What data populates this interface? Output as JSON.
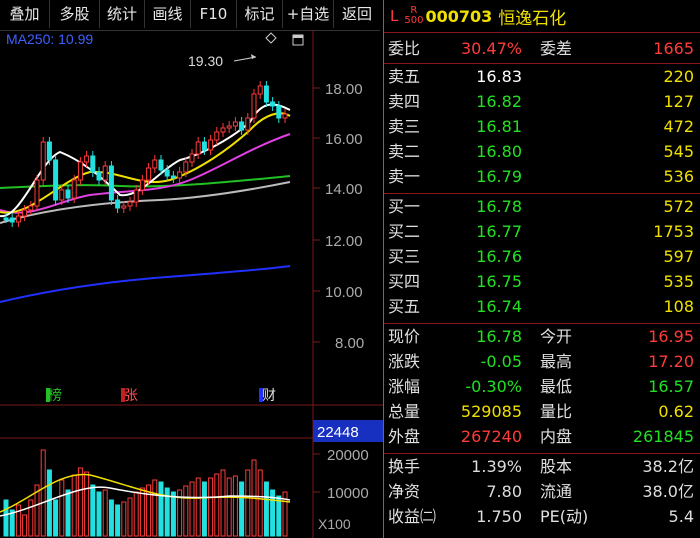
{
  "toolbar": {
    "buttons": [
      "叠加",
      "多股",
      "统计",
      "画线",
      "F10",
      "标记",
      "+自选",
      "返回"
    ]
  },
  "ma_label": "MA250: 10.99",
  "annotation_high": "19.30",
  "markers": [
    "榜",
    "张",
    "财"
  ],
  "price_axis": [
    "18.00",
    "16.00",
    "14.00",
    "12.00",
    "10.00",
    "8.00"
  ],
  "volume_axis": [
    "20000",
    "10000"
  ],
  "volume_unit": "X100",
  "volume_current": "22448",
  "colors": {
    "up": "#ff3b3b",
    "down": "#22e0e0",
    "ma5": "#ffffff",
    "ma10": "#f0e000",
    "ma20": "#e040e0",
    "ma60": "#22c022",
    "ma120": "#bbbbbb",
    "ma250": "#2030ff"
  },
  "stock": {
    "market_mark": "L",
    "rank_top": "R",
    "rank_bottom": "500",
    "code": "000703",
    "name": "恒逸石化"
  },
  "quote": {
    "ratio_label": "委比",
    "ratio": "30.47%",
    "diff_label": "委差",
    "diff": "1665",
    "asks": [
      {
        "label": "卖五",
        "price": "16.83",
        "vol": "220"
      },
      {
        "label": "卖四",
        "price": "16.82",
        "vol": "127"
      },
      {
        "label": "卖三",
        "price": "16.81",
        "vol": "472"
      },
      {
        "label": "卖二",
        "price": "16.80",
        "vol": "545"
      },
      {
        "label": "卖一",
        "price": "16.79",
        "vol": "536"
      }
    ],
    "bids": [
      {
        "label": "买一",
        "price": "16.78",
        "vol": "572"
      },
      {
        "label": "买二",
        "price": "16.77",
        "vol": "1753"
      },
      {
        "label": "买三",
        "price": "16.76",
        "vol": "597"
      },
      {
        "label": "买四",
        "price": "16.75",
        "vol": "535"
      },
      {
        "label": "买五",
        "price": "16.74",
        "vol": "108"
      }
    ],
    "stats": [
      {
        "l1": "现价",
        "v1": "16.78",
        "l2": "今开",
        "v2": "16.95"
      },
      {
        "l1": "涨跌",
        "v1": "-0.05",
        "l2": "最高",
        "v2": "17.20"
      },
      {
        "l1": "涨幅",
        "v1": "-0.30%",
        "l2": "最低",
        "v2": "16.57"
      },
      {
        "l1": "总量",
        "v1": "529085",
        "l2": "量比",
        "v2": "0.62"
      },
      {
        "l1": "外盘",
        "v1": "267240",
        "l2": "内盘",
        "v2": "261845"
      }
    ],
    "fund": [
      {
        "l1": "换手",
        "v1": "1.39%",
        "l2": "股本",
        "v2": "38.2亿"
      },
      {
        "l1": "净资",
        "v1": "7.80",
        "l2": "流通",
        "v2": "38.0亿"
      },
      {
        "l1": "收益㈡",
        "v1": "1.750",
        "l2": "PE(动)",
        "v2": "5.4"
      }
    ]
  }
}
